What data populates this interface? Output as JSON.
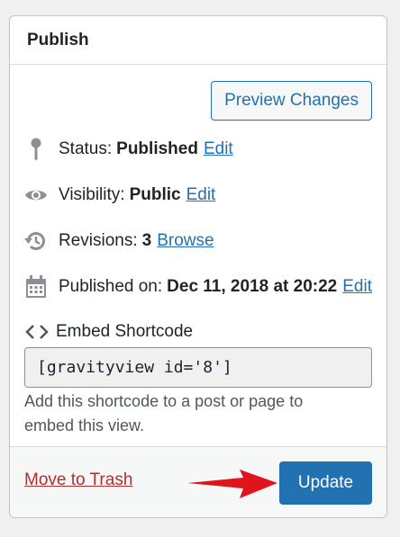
{
  "panel": {
    "title": "Publish"
  },
  "preview": {
    "label": "Preview Changes"
  },
  "status": {
    "label": "Status:",
    "value": "Published",
    "action": "Edit"
  },
  "visibility": {
    "label": "Visibility:",
    "value": "Public",
    "action": "Edit"
  },
  "revisions": {
    "label": "Revisions:",
    "value": "3",
    "action": "Browse"
  },
  "published_on": {
    "label": "Published on:",
    "value": "Dec 11, 2018 at 20:22",
    "action": "Edit"
  },
  "embed": {
    "label": "Embed Shortcode",
    "shortcode": "[gravityview id='8']",
    "help": "Add this shortcode to a post or page to embed this view."
  },
  "footer": {
    "trash_label": "Move to Trash",
    "update_label": "Update"
  },
  "icons": {
    "status": "pin-icon",
    "visibility": "eye-icon",
    "revisions": "history-icon",
    "published_on": "calendar-icon",
    "embed": "code-icon",
    "annotation": "red-arrow-icon"
  },
  "colors": {
    "link": "#2271b1",
    "primary_button": "#2271b1",
    "trash": "#b32d2e",
    "arrow": "#e0141c"
  }
}
